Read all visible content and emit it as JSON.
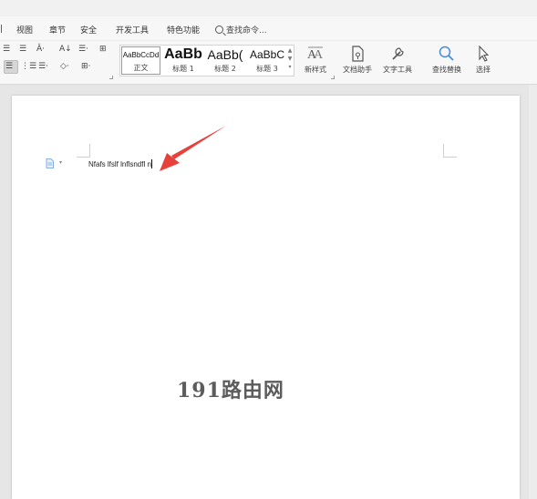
{
  "menubar": {
    "edge_label": "|",
    "items": [
      "视图",
      "章节",
      "安全",
      "开发工具",
      "特色功能"
    ],
    "search_command": "查找命令..."
  },
  "ribbon": {
    "para_row1": [
      "☰",
      "☰",
      "Â·",
      "A↓",
      "☰·",
      "⊞"
    ],
    "para_row2": [
      "☰",
      "⋮☰",
      "☰·",
      "◇·",
      "⊞·"
    ],
    "styles": [
      {
        "sample": "AaBbCcDd",
        "name": "正文",
        "selected": true
      },
      {
        "sample": "AaBb",
        "name": "标题 1",
        "selected": false
      },
      {
        "sample": "AaBb(",
        "name": "标题 2",
        "selected": false
      },
      {
        "sample": "AaBbC",
        "name": "标题 3",
        "selected": false
      }
    ],
    "tools": [
      {
        "label": "新样式",
        "icon": "new-style-icon"
      },
      {
        "label": "文档助手",
        "icon": "doc-assistant-icon"
      },
      {
        "label": "文字工具",
        "icon": "text-tools-icon"
      },
      {
        "label": "查找替换",
        "icon": "find-replace-icon"
      },
      {
        "label": "选择",
        "icon": "select-cursor-icon"
      }
    ]
  },
  "document": {
    "text": "Nfafs lfslf lnflsndfl n",
    "watermark": "191路由网",
    "arrow_color": "#e8403a"
  }
}
